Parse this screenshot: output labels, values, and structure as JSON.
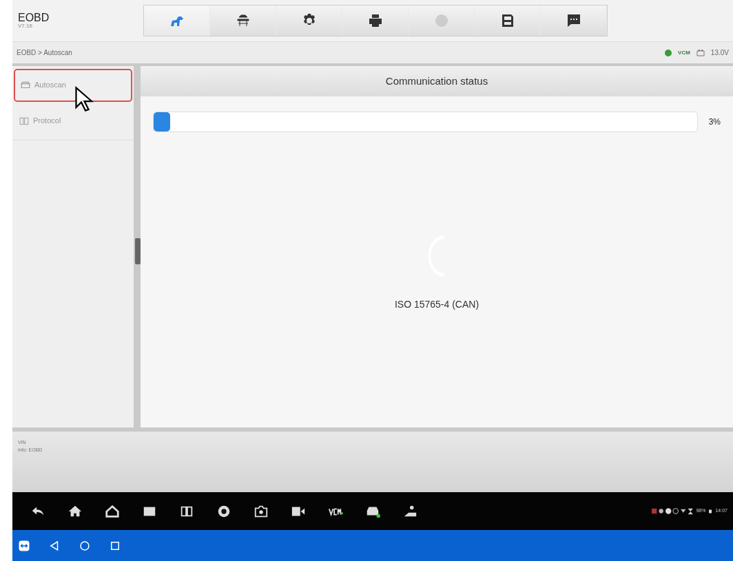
{
  "app": {
    "title": "EOBD",
    "version": "V7.16"
  },
  "toolbar": [
    {
      "selected": true,
      "disabled": false
    },
    {
      "selected": false,
      "disabled": false
    },
    {
      "selected": false,
      "disabled": false
    },
    {
      "selected": false,
      "disabled": false
    },
    {
      "selected": false,
      "disabled": true
    },
    {
      "selected": false,
      "disabled": false
    },
    {
      "selected": false,
      "disabled": false
    }
  ],
  "breadcrumb": "EOBD > Autoscan",
  "vcm_label": "VCM",
  "voltage": "13.0V",
  "sidebar": {
    "items": [
      {
        "label": "Autoscan",
        "selected": true
      },
      {
        "label": "Protocol",
        "selected": false
      }
    ]
  },
  "panel": {
    "title": "Communication status",
    "progress": {
      "level": 0.03,
      "reading": "3%"
    },
    "protocol": "ISO 15765-4 (CAN)"
  },
  "info": [
    "VIN",
    "Info: EOBD"
  ],
  "status_bar": {
    "battery": "98%",
    "time": "14:07"
  }
}
